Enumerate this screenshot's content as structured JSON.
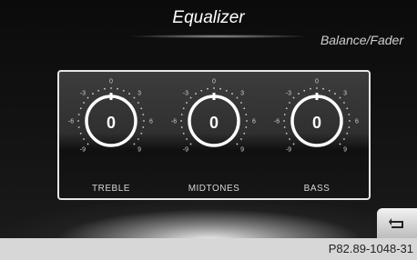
{
  "header": {
    "title": "Equalizer",
    "other_tab": "Balance/Fader"
  },
  "knobs": [
    {
      "label": "TREBLE",
      "value": "0"
    },
    {
      "label": "MIDTONES",
      "value": "0"
    },
    {
      "label": "BASS",
      "value": "0"
    }
  ],
  "scale_labels": {
    "top": "0",
    "left_inner": "-3",
    "right_inner": "3",
    "left_mid": "-6",
    "right_mid": "6",
    "left_outer": "-9",
    "right_outer": "9"
  },
  "footer": {
    "reference": "P82.89-1048-31"
  },
  "colors": {
    "background": "#000000",
    "panel_border": "#e6e6e6",
    "reference_bar": "#d7d7d7"
  },
  "icons": {
    "back": "back-arrow-icon"
  }
}
